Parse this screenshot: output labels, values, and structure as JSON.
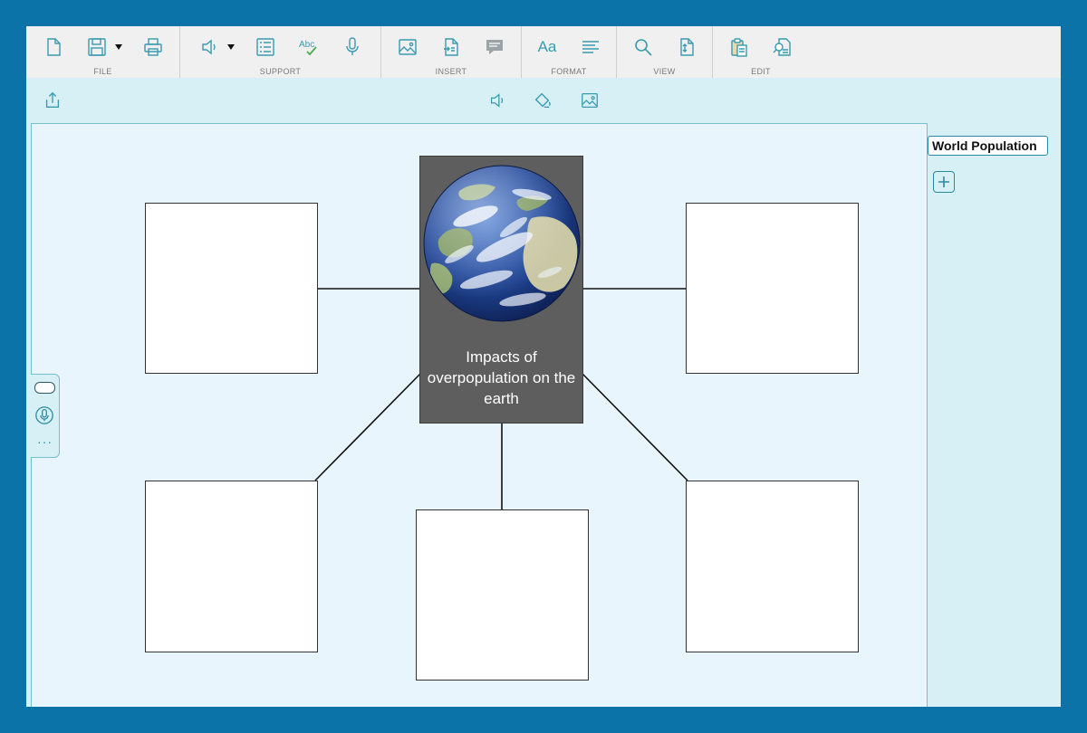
{
  "ribbon": {
    "groups": [
      {
        "label": "FILE"
      },
      {
        "label": "SUPPORT"
      },
      {
        "label": "INSERT"
      },
      {
        "label": "FORMAT"
      },
      {
        "label": "VIEW"
      },
      {
        "label": "EDIT"
      }
    ],
    "format_text_icon": "Aa",
    "spellcheck_text": "Abc"
  },
  "diagram": {
    "center_text": "Impacts of overpopulation on the earth"
  },
  "right_panel": {
    "tab_title": "World Population"
  },
  "left_panel": {
    "more": "···"
  },
  "colors": {
    "frame": "#0b73a8",
    "app_bg": "#d6f0f5",
    "canvas_bg": "#e8f5fd",
    "accent": "#2a8aa0",
    "center_bg": "#5e5e5e"
  }
}
